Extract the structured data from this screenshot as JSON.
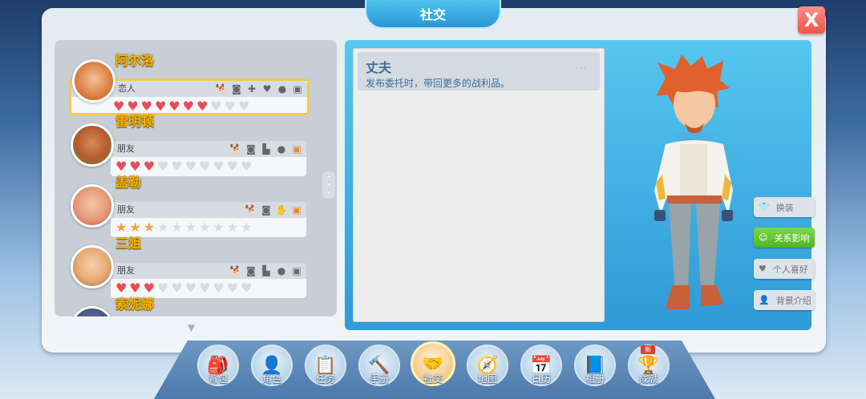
{
  "window": {
    "title": "社交",
    "close_label": "X"
  },
  "friends": [
    {
      "name": "阿尔洛",
      "relation": "恋人",
      "meter_type": "heart",
      "filled": 6.5,
      "total": 10,
      "icons": [
        "dog-icon",
        "camera-icon",
        "puzzle-icon",
        "heart-icon",
        "chat-icon",
        "gift-icon"
      ]
    },
    {
      "name": "雷明顿",
      "relation": "朋友",
      "meter_type": "heart",
      "filled": 3,
      "total": 10,
      "icons": [
        "dog-icon",
        "camera-icon",
        "boot-icon",
        "chat-icon",
        "gift-icon"
      ]
    },
    {
      "name": "盖勒",
      "relation": "朋友",
      "meter_type": "star",
      "filled": 3,
      "total": 10,
      "icons": [
        "dog-icon",
        "camera-icon",
        "glove-icon",
        "gift-icon"
      ]
    },
    {
      "name": "三姐",
      "relation": "朋友",
      "meter_type": "heart",
      "filled": 3,
      "total": 10,
      "icons": [
        "dog-icon",
        "camera-icon",
        "boot-icon",
        "chat-icon",
        "gift-icon"
      ]
    },
    {
      "name": "索妮娜"
    }
  ],
  "relationship": {
    "title": "丈夫",
    "description": "发布委托时，带回更多的战利品。",
    "more": "···"
  },
  "side_buttons": [
    {
      "label": "换装",
      "icon": "shirt-icon",
      "active": false
    },
    {
      "label": "关系影响",
      "icon": "smile-icon",
      "active": true
    },
    {
      "label": "个人喜好",
      "icon": "heart-icon",
      "active": false
    },
    {
      "label": "背景介绍",
      "icon": "person-icon",
      "active": false
    }
  ],
  "nav": [
    {
      "label": "背包",
      "icon": "backpack-icon",
      "glyph": "🎒"
    },
    {
      "label": "角色",
      "icon": "character-icon",
      "glyph": "👤"
    },
    {
      "label": "任务",
      "icon": "quest-icon",
      "glyph": "📋"
    },
    {
      "label": "手册",
      "icon": "hammer-icon",
      "glyph": "🔨"
    },
    {
      "label": "社交",
      "icon": "handshake-icon",
      "glyph": "🤝",
      "active": true
    },
    {
      "label": "地图",
      "icon": "map-icon",
      "glyph": "🧭"
    },
    {
      "label": "日历",
      "icon": "calendar-icon",
      "glyph": "📅"
    },
    {
      "label": "相册",
      "icon": "album-icon",
      "glyph": "📘"
    },
    {
      "label": "成就",
      "icon": "trophy-icon",
      "glyph": "🏆",
      "badge": "新"
    }
  ]
}
